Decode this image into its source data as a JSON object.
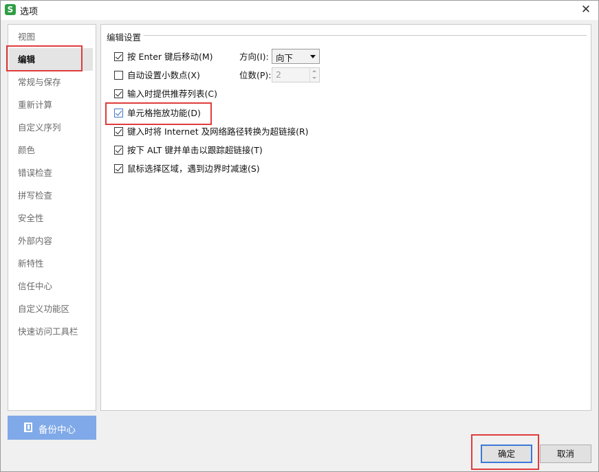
{
  "window": {
    "title": "选项",
    "app_icon_glyph": "S",
    "close_glyph": "✕"
  },
  "sidebar": {
    "items": [
      {
        "label": "视图"
      },
      {
        "label": "编辑",
        "active": true
      },
      {
        "label": "常规与保存"
      },
      {
        "label": "重新计算"
      },
      {
        "label": "自定义序列"
      },
      {
        "label": "颜色"
      },
      {
        "label": "错误检查"
      },
      {
        "label": "拼写检查"
      },
      {
        "label": "安全性"
      },
      {
        "label": "外部内容"
      },
      {
        "label": "新特性"
      },
      {
        "label": "信任中心"
      },
      {
        "label": "自定义功能区"
      },
      {
        "label": "快速访问工具栏"
      }
    ],
    "backup_button": "备份中心"
  },
  "edit_settings": {
    "group_title": "编辑设置",
    "options": [
      {
        "label": "按 Enter 键后移动(M)",
        "checked": true
      },
      {
        "label": "自动设置小数点(X)",
        "checked": false
      },
      {
        "label": "输入时提供推荐列表(C)",
        "checked": true
      },
      {
        "label": "单元格拖放功能(D)",
        "checked": true
      },
      {
        "label": "键入时将 Internet 及网络路径转换为超链接(R)",
        "checked": true
      },
      {
        "label": "按下 ALT 键并单击以跟踪超链接(T)",
        "checked": true
      },
      {
        "label": "鼠标选择区域，遇到边界时减速(S)",
        "checked": true
      }
    ],
    "direction_label": "方向(I):",
    "direction_value": "向下",
    "places_label": "位数(P):",
    "places_value": "2"
  },
  "footer": {
    "ok_label": "确定",
    "cancel_label": "取消"
  },
  "colors": {
    "highlight_box": "#e03b3b",
    "backup_button_bg": "#7fa9e8",
    "app_icon": "#2e9e44"
  }
}
